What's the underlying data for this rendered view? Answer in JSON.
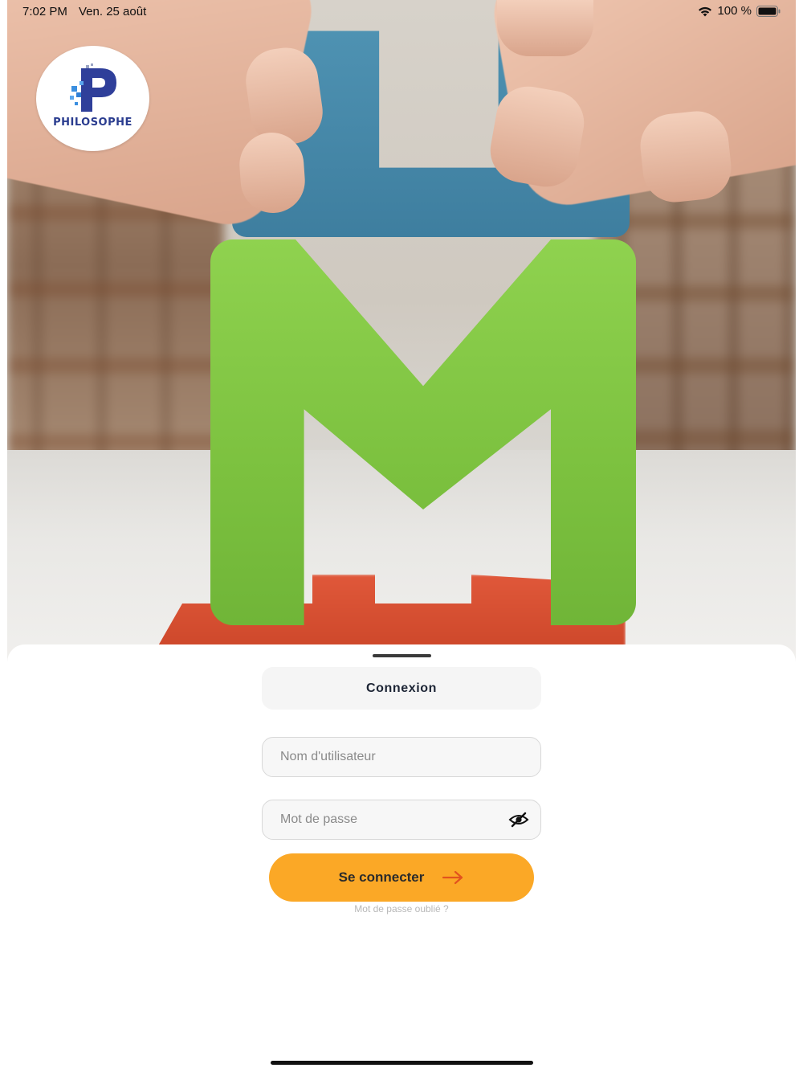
{
  "status_bar": {
    "time": "7:02 PM",
    "date": "Ven. 25 août",
    "battery_percent": "100 %",
    "wifi_icon": "wifi-icon",
    "battery_icon": "battery-full-icon"
  },
  "logo": {
    "text": "PHILOSOPHE",
    "icon": "philosophe-p-logo"
  },
  "hero": {
    "icon": "wooden-letter-blocks-photo"
  },
  "login_sheet": {
    "title": "Connexion",
    "username": {
      "placeholder": "Nom d'utilisateur",
      "value": ""
    },
    "password": {
      "placeholder": "Mot de passe",
      "value": "",
      "toggle_icon": "eye-slash-icon"
    },
    "submit_label": "Se connecter",
    "submit_icon": "arrow-right-icon",
    "forgot_password": "Mot de passe oublié ?"
  },
  "colors": {
    "accent": "#fba826",
    "arrow": "#e2531e",
    "title_text": "#1d2535",
    "logo_blue": "#2a3c8f"
  }
}
